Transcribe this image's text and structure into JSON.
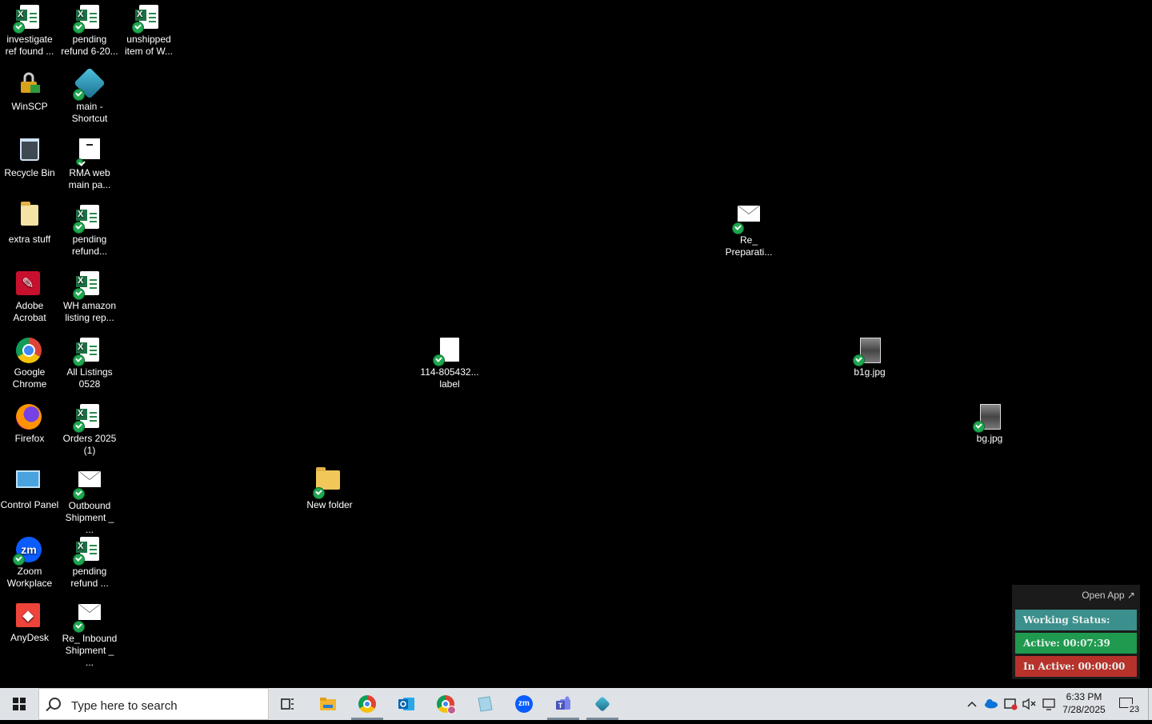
{
  "desktop": {
    "icons": [
      {
        "label": "investigate ref found ..."
      },
      {
        "label": "pending refund 6-20..."
      },
      {
        "label": "unshipped item of W..."
      },
      {
        "label": "WinSCP"
      },
      {
        "label": "main - Shortcut"
      },
      {
        "label": "Recycle Bin"
      },
      {
        "label": "RMA web main pa..."
      },
      {
        "label": "extra stuff"
      },
      {
        "label": "pending refund..."
      },
      {
        "label": "Adobe Acrobat"
      },
      {
        "label": "WH amazon listing rep..."
      },
      {
        "label": "Google Chrome"
      },
      {
        "label": "All Listings 0528"
      },
      {
        "label": "Firefox"
      },
      {
        "label": "Orders 2025 (1)"
      },
      {
        "label": "Control Panel"
      },
      {
        "label": "Outbound Shipment _ ..."
      },
      {
        "label": "Zoom Workplace"
      },
      {
        "label": "pending refund ..."
      },
      {
        "label": "AnyDesk"
      },
      {
        "label": "Re_ Inbound Shipment _ ..."
      },
      {
        "label": "New folder"
      },
      {
        "label": "114-805432... label"
      },
      {
        "label": "Re_ Preparati..."
      },
      {
        "label": "b1g.jpg"
      },
      {
        "label": "bg.jpg"
      }
    ]
  },
  "widget": {
    "open_app": "Open App ↗",
    "working_status": "Working Status: Active",
    "active": "Active: 00:07:39",
    "inactive": "In Active: 00:00:00",
    "colors": {
      "status": "#3b8f8c",
      "active": "#1f9a4e",
      "inactive": "#b7322b"
    }
  },
  "taskbar": {
    "search_placeholder": "Type here to search",
    "apps": [
      "task-view-icon",
      "file-explorer-icon",
      "chrome-icon",
      "outlook-icon",
      "chrome-profile-icon",
      "document-app-icon",
      "zoom-icon",
      "teams-icon",
      "shortcut-app-icon"
    ],
    "clock": {
      "time": "6:33 PM",
      "date": "7/28/2025"
    },
    "notifications_count": "23"
  }
}
